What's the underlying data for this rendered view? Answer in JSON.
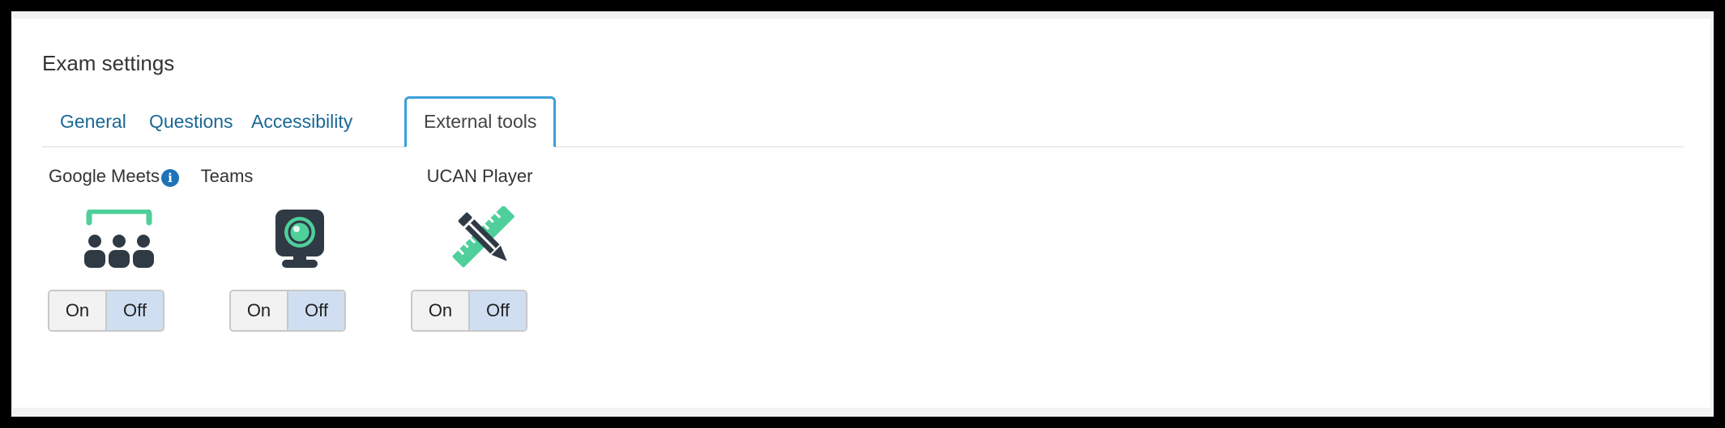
{
  "page": {
    "title": "Exam settings"
  },
  "tabs": [
    {
      "label": "General",
      "active": false
    },
    {
      "label": "Questions",
      "active": false
    },
    {
      "label": "Accessibility",
      "active": false
    },
    {
      "label": "External tools",
      "active": true
    }
  ],
  "tools": [
    {
      "label": "Google Meets",
      "icon": "meeting-icon",
      "has_info": true,
      "state": "Off"
    },
    {
      "label": "Teams",
      "icon": "webcam-icon",
      "has_info": false,
      "state": "Off"
    },
    {
      "label": "UCAN Player",
      "icon": "pencil-ruler-icon",
      "has_info": false,
      "state": "Off"
    }
  ],
  "toggle": {
    "on_label": "On",
    "off_label": "Off"
  },
  "info_glyph": "i",
  "colors": {
    "tab_link": "#1a6896",
    "tab_active_border": "#3aa0d8",
    "icon_dark": "#2f3a45",
    "icon_accent": "#4fcf9a",
    "info_badge": "#1e73b8",
    "toggle_selected": "#cfdff1"
  }
}
